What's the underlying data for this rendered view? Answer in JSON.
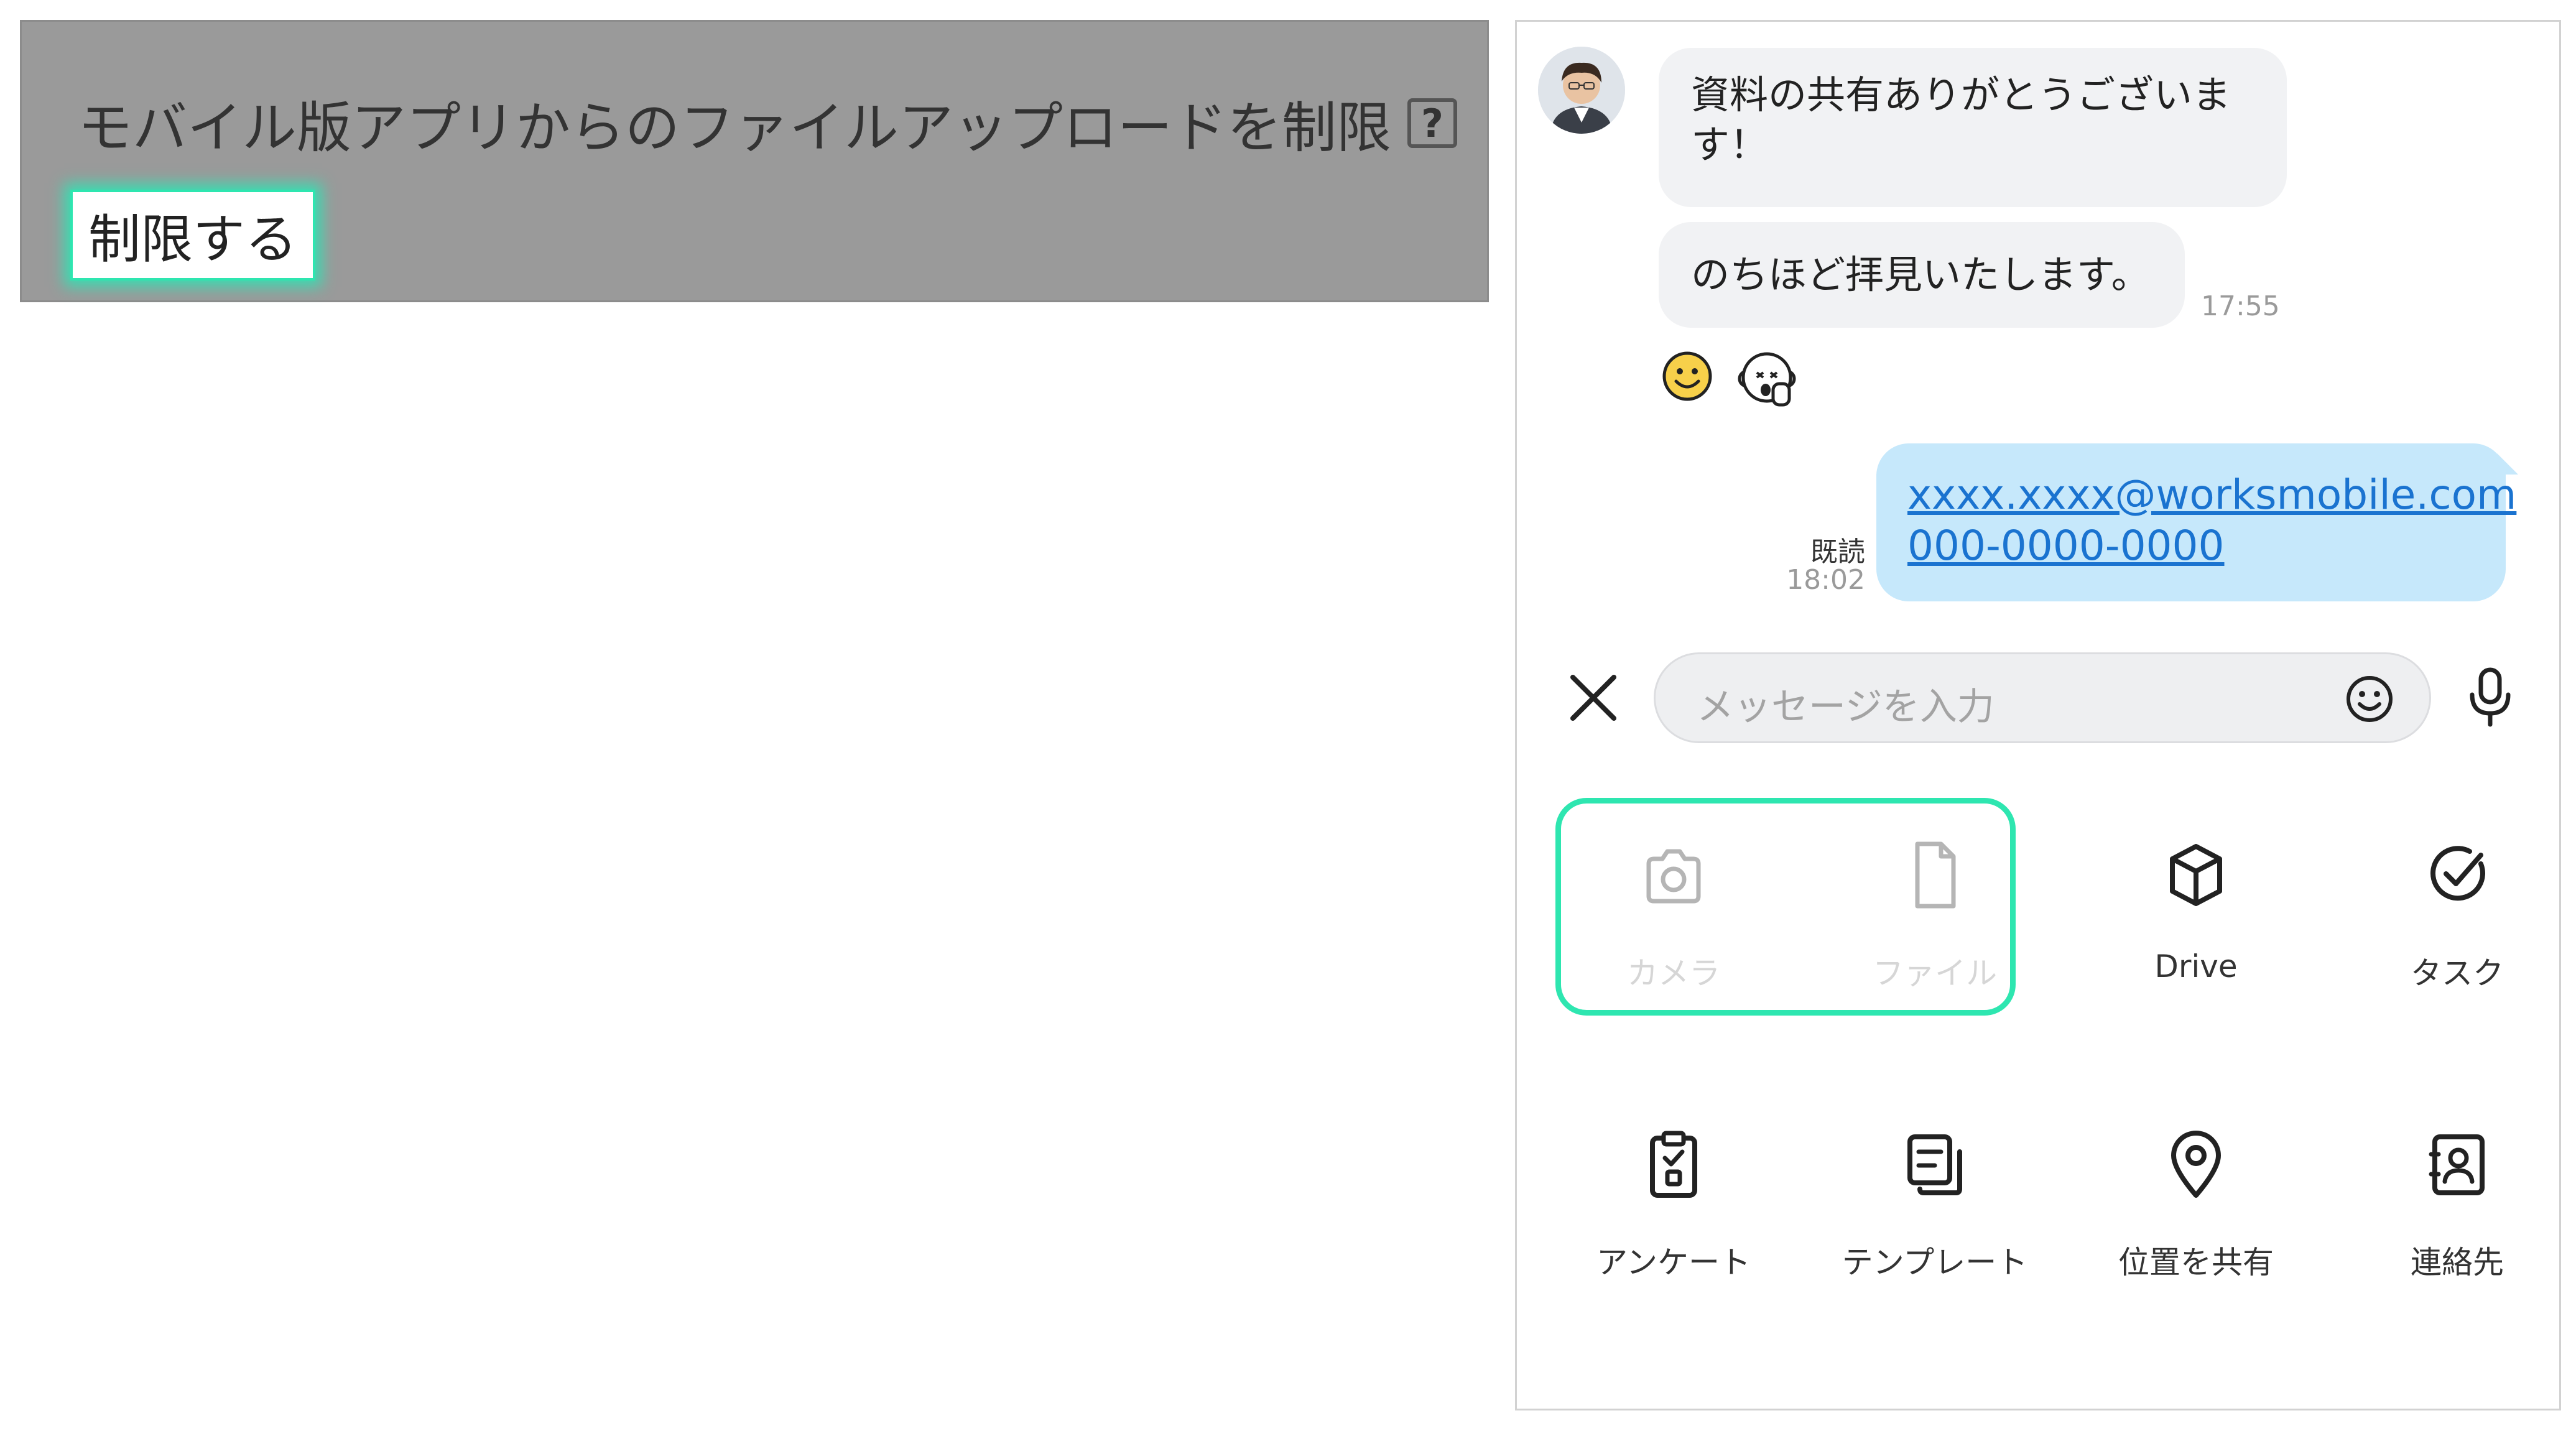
{
  "admin": {
    "setting_title": "モバイル版アプリからのファイルアップロードを制限",
    "help_label": "?",
    "restrict_button": "制限する"
  },
  "chat": {
    "messages_in": [
      "資料の共有ありがとうございます！",
      "のちほど拝見いたします。"
    ],
    "time_in": "17:55",
    "reactions": [
      "smile-emoji",
      "monkey-emoji"
    ],
    "message_out": {
      "email": "xxxx.xxxx@worksmobile.com",
      "phone": "000-0000-0000"
    },
    "read_label": "既読",
    "time_out": "18:02",
    "input_placeholder": "メッセージを入力",
    "attachments": [
      {
        "label": "カメラ",
        "icon": "camera-icon",
        "disabled": true
      },
      {
        "label": "ファイル",
        "icon": "file-icon",
        "disabled": true
      },
      {
        "label": "Drive",
        "icon": "drive-icon",
        "disabled": false
      },
      {
        "label": "タスク",
        "icon": "task-icon",
        "disabled": false
      },
      {
        "label": "アンケート",
        "icon": "survey-icon",
        "disabled": false
      },
      {
        "label": "テンプレート",
        "icon": "template-icon",
        "disabled": false
      },
      {
        "label": "位置を共有",
        "icon": "location-icon",
        "disabled": false
      },
      {
        "label": "連絡先",
        "icon": "contact-icon",
        "disabled": false
      }
    ]
  },
  "colors": {
    "highlight": "#2ee6b0",
    "admin_bg": "#9a9a9a",
    "incoming_bubble": "#f1f2f4",
    "outgoing_bubble": "#c6e8fb",
    "link": "#1a73d0"
  }
}
